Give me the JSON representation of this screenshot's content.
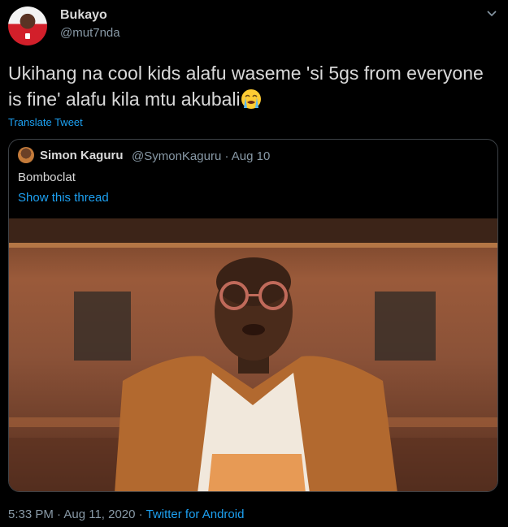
{
  "tweet": {
    "author_name": "Bukayo",
    "author_handle": "@mut7nda",
    "text": "Ukihang na cool kids alafu waseme 'si  5gs from everyone is fine' alafu kila mtu akubali",
    "emoji": "loudly-crying-face-icon",
    "translate_label": "Translate Tweet",
    "time": "5:33 PM · Aug 11, 2020 · ",
    "source": "Twitter for Android"
  },
  "quoted_tweet": {
    "author_name": "Simon Kaguru",
    "author_meta": "@SymonKaguru · Aug 10",
    "text": "Bomboclat",
    "thread_label": "Show this thread"
  },
  "colors": {
    "background": "#000000",
    "text": "#d9d9d9",
    "muted": "#8899a6",
    "link": "#1da1f2",
    "border": "#3d4247"
  }
}
